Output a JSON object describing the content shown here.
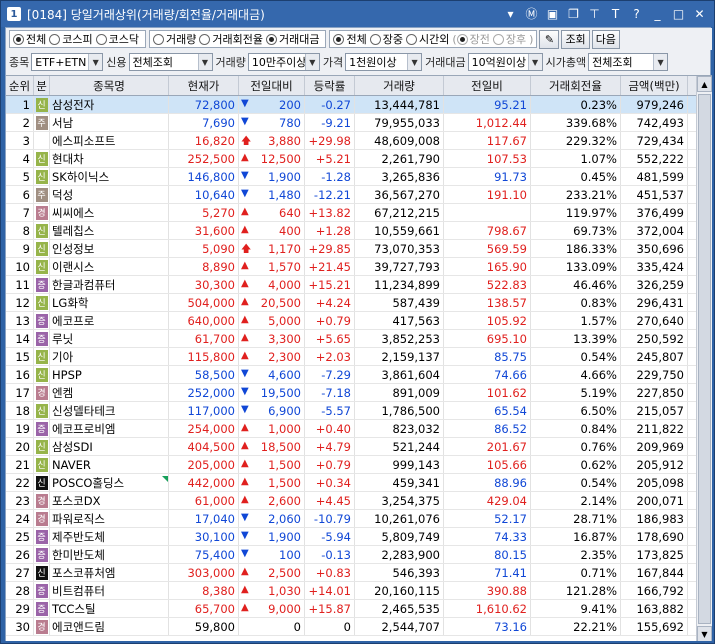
{
  "window": {
    "number": "1",
    "title": "[0184] 당일거래상위(거래량/회전율/거래대금)"
  },
  "titlebar_icons": [
    "menu-down-icon",
    "m-icon",
    "window-icon",
    "copy-icon",
    "pin-icon",
    "font-icon",
    "help-icon",
    "minimize-icon",
    "maximize-icon",
    "close-icon"
  ],
  "market_filter": [
    {
      "label": "전체",
      "selected": true
    },
    {
      "label": "코스피",
      "selected": false
    },
    {
      "label": "코스닥",
      "selected": false
    }
  ],
  "sort_filter": [
    {
      "label": "거래량",
      "selected": false
    },
    {
      "label": "거래회전율",
      "selected": false
    },
    {
      "label": "거래대금",
      "selected": true
    }
  ],
  "session_filter": [
    {
      "label": "전체",
      "selected": true
    },
    {
      "label": "장중",
      "selected": false
    },
    {
      "label": "시간외",
      "selected": false
    }
  ],
  "session_sub_filter": [
    {
      "label": "장전",
      "selected": true
    },
    {
      "label": "장후",
      "selected": false
    }
  ],
  "buttons": {
    "query": "조회",
    "next": "다음"
  },
  "filters": {
    "item_label": "종목",
    "item_value": "ETF+ETN 제",
    "credit_label": "신용",
    "credit_value": "전체조회",
    "volume_label": "거래량",
    "volume_value": "10만주이상",
    "price_label": "가격",
    "price_value": "1천원이상",
    "amount_label": "거래대금",
    "amount_value": "10억원이상",
    "cap_label": "시가총액",
    "cap_value": "전체조회"
  },
  "columns": [
    "순위",
    "분",
    "종목명",
    "현재가",
    "전일대비",
    "등락률",
    "거래량",
    "전일비",
    "거래회전율",
    "금액(백만)"
  ],
  "rows": [
    {
      "rank": "1",
      "div": "신",
      "badge": "s",
      "name": "삼성전자",
      "price": "72,800",
      "dir": "dn",
      "chg": "200",
      "rate": "-0.27",
      "vol": "13,444,781",
      "prev": "95.21",
      "turn": "0.23%",
      "amt": "979,246"
    },
    {
      "rank": "2",
      "div": "주",
      "badge": "j",
      "name": "서남",
      "price": "7,690",
      "dir": "dn",
      "chg": "780",
      "rate": "-9.21",
      "vol": "79,955,033",
      "prev": "1,012.44",
      "turn": "339.68%",
      "amt": "742,493"
    },
    {
      "rank": "3",
      "div": "",
      "badge": "",
      "name": "에스피소프트",
      "price": "16,820",
      "dir": "uplim",
      "chg": "3,880",
      "rate": "+29.98",
      "vol": "48,609,008",
      "prev": "117.67",
      "turn": "229.32%",
      "amt": "729,434"
    },
    {
      "rank": "4",
      "div": "신",
      "badge": "s",
      "name": "현대차",
      "price": "252,500",
      "dir": "up",
      "chg": "12,500",
      "rate": "+5.21",
      "vol": "2,261,790",
      "prev": "107.53",
      "turn": "1.07%",
      "amt": "552,222"
    },
    {
      "rank": "5",
      "div": "신",
      "badge": "s",
      "name": "SK하이닉스",
      "price": "146,800",
      "dir": "dn",
      "chg": "1,900",
      "rate": "-1.28",
      "vol": "3,265,836",
      "prev": "91.73",
      "turn": "0.45%",
      "amt": "481,599"
    },
    {
      "rank": "6",
      "div": "주",
      "badge": "j",
      "name": "덕성",
      "price": "10,640",
      "dir": "dn",
      "chg": "1,480",
      "rate": "-12.21",
      "vol": "36,567,270",
      "prev": "191.10",
      "turn": "233.21%",
      "amt": "451,537"
    },
    {
      "rank": "7",
      "div": "경",
      "badge": "k",
      "name": "씨씨에스",
      "price": "5,270",
      "dir": "up",
      "chg": "640",
      "rate": "+13.82",
      "vol": "67,212,215",
      "prev": "",
      "turn": "119.97%",
      "amt": "376,499"
    },
    {
      "rank": "8",
      "div": "신",
      "badge": "s",
      "name": "텔레칩스",
      "price": "31,600",
      "dir": "up",
      "chg": "400",
      "rate": "+1.28",
      "vol": "10,559,661",
      "prev": "798.67",
      "turn": "69.73%",
      "amt": "372,004"
    },
    {
      "rank": "9",
      "div": "신",
      "badge": "s",
      "name": "인성정보",
      "price": "5,090",
      "dir": "uplim",
      "chg": "1,170",
      "rate": "+29.85",
      "vol": "73,070,353",
      "prev": "569.59",
      "turn": "186.33%",
      "amt": "350,696"
    },
    {
      "rank": "10",
      "div": "신",
      "badge": "s",
      "name": "이랜시스",
      "price": "8,890",
      "dir": "up",
      "chg": "1,570",
      "rate": "+21.45",
      "vol": "39,727,793",
      "prev": "165.90",
      "turn": "133.09%",
      "amt": "335,424"
    },
    {
      "rank": "11",
      "div": "증",
      "badge": "g",
      "name": "한글과컴퓨터",
      "price": "30,300",
      "dir": "up",
      "chg": "4,000",
      "rate": "+15.21",
      "vol": "11,234,899",
      "prev": "522.83",
      "turn": "46.46%",
      "amt": "326,259"
    },
    {
      "rank": "12",
      "div": "신",
      "badge": "s",
      "name": "LG화학",
      "price": "504,000",
      "dir": "up",
      "chg": "20,500",
      "rate": "+4.24",
      "vol": "587,439",
      "prev": "138.57",
      "turn": "0.83%",
      "amt": "296,431"
    },
    {
      "rank": "13",
      "div": "증",
      "badge": "g",
      "name": "에코프로",
      "price": "640,000",
      "dir": "up",
      "chg": "5,000",
      "rate": "+0.79",
      "vol": "417,563",
      "prev": "105.92",
      "turn": "1.57%",
      "amt": "270,640"
    },
    {
      "rank": "14",
      "div": "증",
      "badge": "g",
      "name": "루닛",
      "price": "61,700",
      "dir": "up",
      "chg": "3,300",
      "rate": "+5.65",
      "vol": "3,852,253",
      "prev": "695.10",
      "turn": "13.39%",
      "amt": "250,592"
    },
    {
      "rank": "15",
      "div": "신",
      "badge": "s",
      "name": "기아",
      "price": "115,800",
      "dir": "up",
      "chg": "2,300",
      "rate": "+2.03",
      "vol": "2,159,137",
      "prev": "85.75",
      "turn": "0.54%",
      "amt": "245,807"
    },
    {
      "rank": "16",
      "div": "신",
      "badge": "s",
      "name": "HPSP",
      "price": "58,500",
      "dir": "dn",
      "chg": "4,600",
      "rate": "-7.29",
      "vol": "3,861,604",
      "prev": "74.66",
      "turn": "4.66%",
      "amt": "229,750"
    },
    {
      "rank": "17",
      "div": "경",
      "badge": "k",
      "name": "엔켐",
      "price": "252,000",
      "dir": "dn",
      "chg": "19,500",
      "rate": "-7.18",
      "vol": "891,009",
      "prev": "101.62",
      "turn": "5.19%",
      "amt": "227,850"
    },
    {
      "rank": "18",
      "div": "신",
      "badge": "s",
      "name": "신성델타테크",
      "price": "117,000",
      "dir": "dn",
      "chg": "6,900",
      "rate": "-5.57",
      "vol": "1,786,500",
      "prev": "65.54",
      "turn": "6.50%",
      "amt": "215,057"
    },
    {
      "rank": "19",
      "div": "증",
      "badge": "g",
      "name": "에코프로비엠",
      "price": "254,000",
      "dir": "up",
      "chg": "1,000",
      "rate": "+0.40",
      "vol": "823,032",
      "prev": "86.52",
      "turn": "0.84%",
      "amt": "211,822"
    },
    {
      "rank": "20",
      "div": "신",
      "badge": "s",
      "name": "삼성SDI",
      "price": "404,500",
      "dir": "up",
      "chg": "18,500",
      "rate": "+4.79",
      "vol": "521,244",
      "prev": "201.67",
      "turn": "0.76%",
      "amt": "209,969"
    },
    {
      "rank": "21",
      "div": "신",
      "badge": "s",
      "name": "NAVER",
      "price": "205,000",
      "dir": "up",
      "chg": "1,500",
      "rate": "+0.79",
      "vol": "999,143",
      "prev": "105.66",
      "turn": "0.62%",
      "amt": "205,912"
    },
    {
      "rank": "22",
      "div": "신",
      "badge": "n",
      "name": "POSCO홀딩스",
      "price": "442,000",
      "dir": "up",
      "chg": "1,500",
      "rate": "+0.34",
      "vol": "459,341",
      "prev": "88.96",
      "turn": "0.54%",
      "amt": "205,098"
    },
    {
      "rank": "23",
      "div": "경",
      "badge": "k",
      "name": "포스코DX",
      "price": "61,000",
      "dir": "up",
      "chg": "2,600",
      "rate": "+4.45",
      "vol": "3,254,375",
      "prev": "429.04",
      "turn": "2.14%",
      "amt": "200,071"
    },
    {
      "rank": "24",
      "div": "경",
      "badge": "k",
      "name": "파워로직스",
      "price": "17,040",
      "dir": "dn",
      "chg": "2,060",
      "rate": "-10.79",
      "vol": "10,261,076",
      "prev": "52.17",
      "turn": "28.71%",
      "amt": "186,983"
    },
    {
      "rank": "25",
      "div": "증",
      "badge": "g",
      "name": "제주반도체",
      "price": "30,100",
      "dir": "dn",
      "chg": "1,900",
      "rate": "-5.94",
      "vol": "5,809,749",
      "prev": "74.33",
      "turn": "16.87%",
      "amt": "178,690"
    },
    {
      "rank": "26",
      "div": "증",
      "badge": "g",
      "name": "한미반도체",
      "price": "75,400",
      "dir": "dn",
      "chg": "100",
      "rate": "-0.13",
      "vol": "2,283,900",
      "prev": "80.15",
      "turn": "2.35%",
      "amt": "173,825"
    },
    {
      "rank": "27",
      "div": "신",
      "badge": "n",
      "name": "포스코퓨처엠",
      "price": "303,000",
      "dir": "up",
      "chg": "2,500",
      "rate": "+0.83",
      "vol": "546,393",
      "prev": "71.41",
      "turn": "0.71%",
      "amt": "167,844"
    },
    {
      "rank": "28",
      "div": "증",
      "badge": "g",
      "name": "비트컴퓨터",
      "price": "8,380",
      "dir": "up",
      "chg": "1,030",
      "rate": "+14.01",
      "vol": "20,160,115",
      "prev": "390.88",
      "turn": "121.28%",
      "amt": "166,792"
    },
    {
      "rank": "29",
      "div": "증",
      "badge": "g",
      "name": "TCC스틸",
      "price": "65,700",
      "dir": "up",
      "chg": "9,000",
      "rate": "+15.87",
      "vol": "2,465,535",
      "prev": "1,610.62",
      "turn": "9.41%",
      "amt": "163,882"
    },
    {
      "rank": "30",
      "div": "경",
      "badge": "k",
      "name": "에코앤드림",
      "price": "59,800",
      "dir": "flat",
      "chg": "0",
      "rate": "0",
      "vol": "2,544,707",
      "prev": "73.16",
      "turn": "22.21%",
      "amt": "155,692"
    }
  ]
}
